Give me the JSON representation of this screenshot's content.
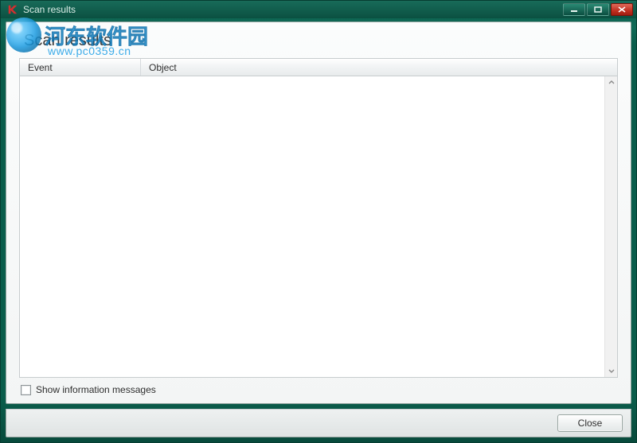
{
  "window": {
    "title": "Scan results"
  },
  "page": {
    "heading": "Scan results"
  },
  "table": {
    "columns": {
      "event": "Event",
      "object": "Object"
    },
    "rows": []
  },
  "footer": {
    "show_info_label": "Show information messages",
    "show_info_checked": false
  },
  "buttons": {
    "close": "Close"
  },
  "watermark": {
    "text_cn": "河东软件园",
    "url": "www.pc0359.cn"
  },
  "icons": {
    "app": "kaspersky-k-icon",
    "minimize": "minimize-icon",
    "maximize": "maximize-icon",
    "close": "close-icon",
    "scroll_up": "chevron-up-icon",
    "scroll_down": "chevron-down-icon"
  },
  "colors": {
    "frame": "#0a5d4b",
    "close_btn": "#c03020",
    "accent_blue": "#1a9ee6"
  }
}
